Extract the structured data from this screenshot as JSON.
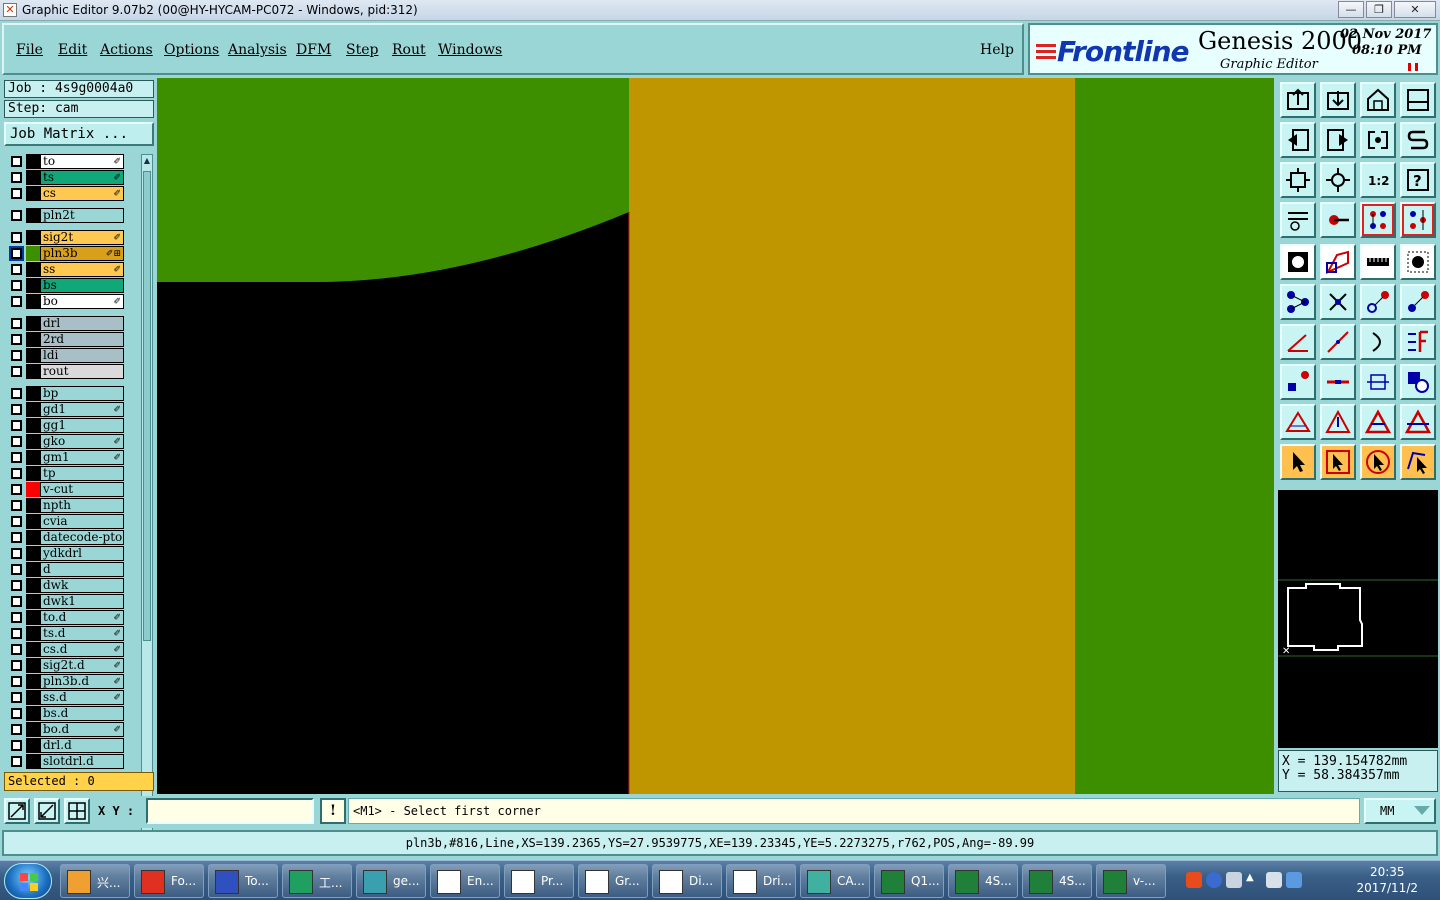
{
  "window": {
    "title": "Graphic Editor 9.07b2 (00@HY-HYCAM-PC072 - Windows, pid:312)",
    "minimize": "—",
    "maximize": "❐",
    "close": "✕"
  },
  "menu": {
    "items": [
      "File",
      "Edit",
      "Actions",
      "Options",
      "Analysis",
      "DFM",
      "Step",
      "Rout",
      "Windows"
    ],
    "help": "Help"
  },
  "brand": {
    "logo": "Frontline",
    "product": "Genesis 2000",
    "subtitle": "Graphic Editor",
    "date": "02 Nov 2017",
    "time": "08:10 PM"
  },
  "job": {
    "job_label": "Job : 4s9g0004a0",
    "step_label": "Step: cam",
    "matrix_button": "Job Matrix ..."
  },
  "layers": [
    {
      "name": "to",
      "color": "#ffffff",
      "icon": "✐"
    },
    {
      "name": "ts",
      "color": "#10a878",
      "icon": "✐"
    },
    {
      "name": "cs",
      "color": "#ffc850",
      "icon": "✐"
    },
    {
      "name": "pln2t",
      "color": "#9ad6d6",
      "icon": ""
    },
    {
      "name": "sig2t",
      "color": "#ffc850",
      "icon": "✐"
    },
    {
      "name": "pln3b",
      "color": "#d8a018",
      "icon": "✐⊞",
      "selected": true
    },
    {
      "name": "ss",
      "color": "#ffc850",
      "icon": "✐"
    },
    {
      "name": "bs",
      "color": "#10a878",
      "icon": ""
    },
    {
      "name": "bo",
      "color": "#ffffff",
      "icon": "✐"
    },
    {
      "name": "drl",
      "color": "#a8bfc8",
      "icon": ""
    },
    {
      "name": "2rd",
      "color": "#a8bfc8",
      "icon": ""
    },
    {
      "name": "ldi",
      "color": "#a8bfc8",
      "icon": ""
    },
    {
      "name": "rout",
      "color": "#dadada",
      "icon": ""
    },
    {
      "name": "bp",
      "color": "#9ad6d6",
      "icon": ""
    },
    {
      "name": "gd1",
      "color": "#9ad6d6",
      "icon": "✐"
    },
    {
      "name": "gg1",
      "color": "#9ad6d6",
      "icon": ""
    },
    {
      "name": "gko",
      "color": "#9ad6d6",
      "icon": "✐"
    },
    {
      "name": "gm1",
      "color": "#9ad6d6",
      "icon": "✐"
    },
    {
      "name": "tp",
      "color": "#9ad6d6",
      "icon": ""
    },
    {
      "name": "v-cut",
      "color": "#9ad6d6",
      "icon": "",
      "swatch": "#ff0000"
    },
    {
      "name": "npth",
      "color": "#9ad6d6",
      "icon": ""
    },
    {
      "name": "cvia",
      "color": "#9ad6d6",
      "icon": ""
    },
    {
      "name": "datecode-pto",
      "color": "#9ad6d6",
      "icon": ""
    },
    {
      "name": "ydkdrl",
      "color": "#9ad6d6",
      "icon": ""
    },
    {
      "name": "d",
      "color": "#9ad6d6",
      "icon": ""
    },
    {
      "name": "dwk",
      "color": "#9ad6d6",
      "icon": ""
    },
    {
      "name": "dwk1",
      "color": "#9ad6d6",
      "icon": ""
    },
    {
      "name": "to.d",
      "color": "#9ad6d6",
      "icon": "✐"
    },
    {
      "name": "ts.d",
      "color": "#9ad6d6",
      "icon": "✐"
    },
    {
      "name": "cs.d",
      "color": "#9ad6d6",
      "icon": "✐"
    },
    {
      "name": "sig2t.d",
      "color": "#9ad6d6",
      "icon": "✐"
    },
    {
      "name": "pln3b.d",
      "color": "#9ad6d6",
      "icon": "✐"
    },
    {
      "name": "ss.d",
      "color": "#9ad6d6",
      "icon": "✐"
    },
    {
      "name": "bs.d",
      "color": "#9ad6d6",
      "icon": ""
    },
    {
      "name": "bo.d",
      "color": "#9ad6d6",
      "icon": "✐"
    },
    {
      "name": "drl.d",
      "color": "#9ad6d6",
      "icon": ""
    },
    {
      "name": "slotdrl.d",
      "color": "#9ad6d6",
      "icon": ""
    }
  ],
  "selected_count": "Selected : 0",
  "canvas_colors": {
    "green": "#3d8f00",
    "gold": "#bf9600",
    "black": "#000000"
  },
  "coords": {
    "x": "X = 139.154782mm",
    "y": "Y = 58.384357mm"
  },
  "command": {
    "xy_label": "X Y :",
    "xy_value": "",
    "bang": "!",
    "prompt": "<M1> - Select first corner",
    "units": "MM"
  },
  "status_line": "pln3b,#816,Line,XS=139.2365,YS=27.9539775,XE=139.23345,YE=5.2273275,r762,POS,Ang=-89.99",
  "taskbar": {
    "tasks": [
      {
        "label": "兴...",
        "icon": "shell-icon"
      },
      {
        "label": "Fo...",
        "icon": "foxit-icon"
      },
      {
        "label": "To...",
        "icon": "floppy-icon"
      },
      {
        "label": "工...",
        "icon": "p-app-icon"
      },
      {
        "label": "ge...",
        "icon": "eye-icon"
      },
      {
        "label": "En...",
        "icon": "editor-icon"
      },
      {
        "label": "Pr...",
        "icon": "editor-icon"
      },
      {
        "label": "Gr...",
        "icon": "editor-icon"
      },
      {
        "label": "Di...",
        "icon": "editor-icon"
      },
      {
        "label": "Dri...",
        "icon": "editor-icon"
      },
      {
        "label": "CA...",
        "icon": "cam-icon"
      },
      {
        "label": "Q1...",
        "icon": "excel-icon"
      },
      {
        "label": "4S...",
        "icon": "excel-icon"
      },
      {
        "label": "4S...",
        "icon": "excel-icon"
      },
      {
        "label": "v-...",
        "icon": "excel-icon"
      }
    ],
    "clock_time": "20:35",
    "clock_date": "2017/11/2"
  }
}
